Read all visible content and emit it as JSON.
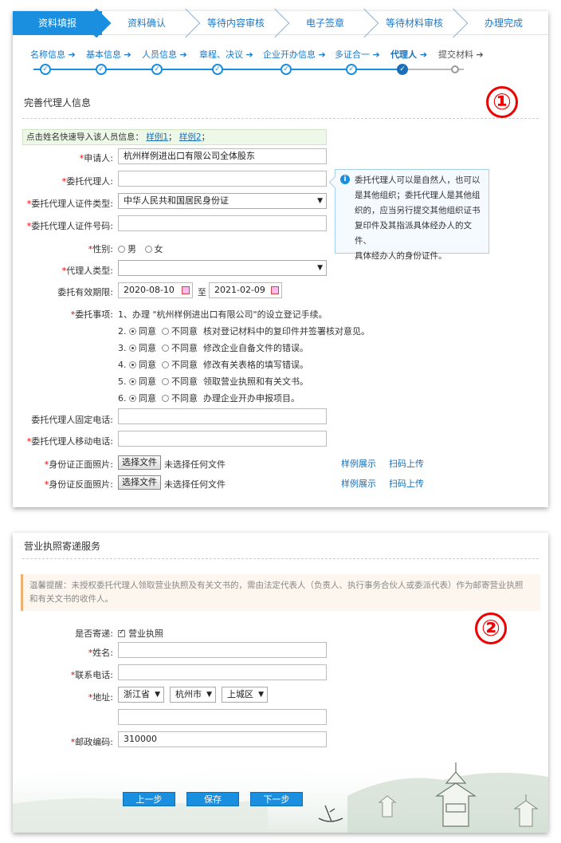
{
  "steps": [
    "资料填报",
    "资料确认",
    "等待内容审核",
    "电子签章",
    "等待材料审核",
    "办理完成"
  ],
  "substeps": [
    {
      "label": "名称信息 ➔",
      "state": "done"
    },
    {
      "label": "基本信息 ➔",
      "state": "done"
    },
    {
      "label": "人员信息 ➔",
      "state": "done"
    },
    {
      "label": "章程、决议 ➔",
      "state": "done"
    },
    {
      "label": "企业开办信息 ➔",
      "state": "done"
    },
    {
      "label": "多证合一 ➔",
      "state": "done"
    },
    {
      "label": "代理人 ➔",
      "state": "current"
    },
    {
      "label": "提交材料 ➔",
      "state": "pending"
    }
  ],
  "section1": {
    "title": "完善代理人信息",
    "marker": "①",
    "import_text": "点击姓名快速导入该人员信息：",
    "sample1": "样例1",
    "sample2": "样例2",
    "sep": "；",
    "tail": "；"
  },
  "form": {
    "applicant_label": "申请人:",
    "applicant_value": "杭州样例进出口有限公司全体股东",
    "agent_label": "委托代理人:",
    "agent_value": "",
    "id_type_label": "委托代理人证件类型:",
    "id_type_value": "中华人民共和国居民身份证",
    "id_no_label": "委托代理人证件号码:",
    "id_no_value": "",
    "gender_label": "性别:",
    "gender_male": "男",
    "gender_female": "女",
    "agent_type_label": "代理人类型:",
    "agent_type_value": "",
    "period_label": "委托有效期限:",
    "period_from": "2020-08-10",
    "period_to_sep": "至",
    "period_to": "2021-02-09",
    "matters_label": "委托事项:",
    "matter1": "1、办理 \"杭州样例进出口有限公司\"的设立登记手续。",
    "matters": [
      {
        "num": "2.",
        "agree": "同意",
        "disagree": "不同意",
        "text": "核对登记材料中的复印件并签署核对意见。"
      },
      {
        "num": "3.",
        "agree": "同意",
        "disagree": "不同意",
        "text": "修改企业自备文件的错误。"
      },
      {
        "num": "4.",
        "agree": "同意",
        "disagree": "不同意",
        "text": "修改有关表格的填写错误。"
      },
      {
        "num": "5.",
        "agree": "同意",
        "disagree": "不同意",
        "text": "领取营业执照和有关文书。"
      },
      {
        "num": "6.",
        "agree": "同意",
        "disagree": "不同意",
        "text": "办理企业开办申报项目。"
      }
    ],
    "landline_label": "委托代理人固定电话:",
    "mobile_label": "委托代理人移动电话:",
    "id_front_label": "身份证正面照片:",
    "id_back_label": "身份证反面照片:",
    "choose_file": "选择文件",
    "no_file": "未选择任何文件",
    "sample_show": "样例展示",
    "scan_upload": "扫码上传"
  },
  "tip": {
    "icon": "i",
    "lines": [
      "委托代理人可以是自然人，也可以",
      "是其他组织；委托代理人是其他组",
      "织的，应当另行提交其他组织证书",
      "复印件及其指派具体经办人的文件、",
      "具体经办人的身份证件。"
    ]
  },
  "section2": {
    "title": "营业执照寄递服务",
    "marker": "②",
    "notice_line1": "温馨提醒：未授权委托代理人领取营业执照及有关文书的，需由法定代表人（负责人、执行事务合伙人或委派代表）作为邮寄营业执照",
    "notice_line2": "和有关文书的收件人。",
    "mail_label": "是否寄递:",
    "mail_option": "营业执照",
    "name_label": "姓名:",
    "phone_label": "联系电话:",
    "address_label": "地址:",
    "province": "浙江省",
    "city": "杭州市",
    "district": "上城区",
    "zip_label": "邮政编码:",
    "zip_value": "310000",
    "btn_prev": "上一步",
    "btn_save": "保存",
    "btn_next": "下一步"
  },
  "colors": {
    "accent": "#1a8fe0",
    "required": "#e00000",
    "marker": "#e00000"
  }
}
